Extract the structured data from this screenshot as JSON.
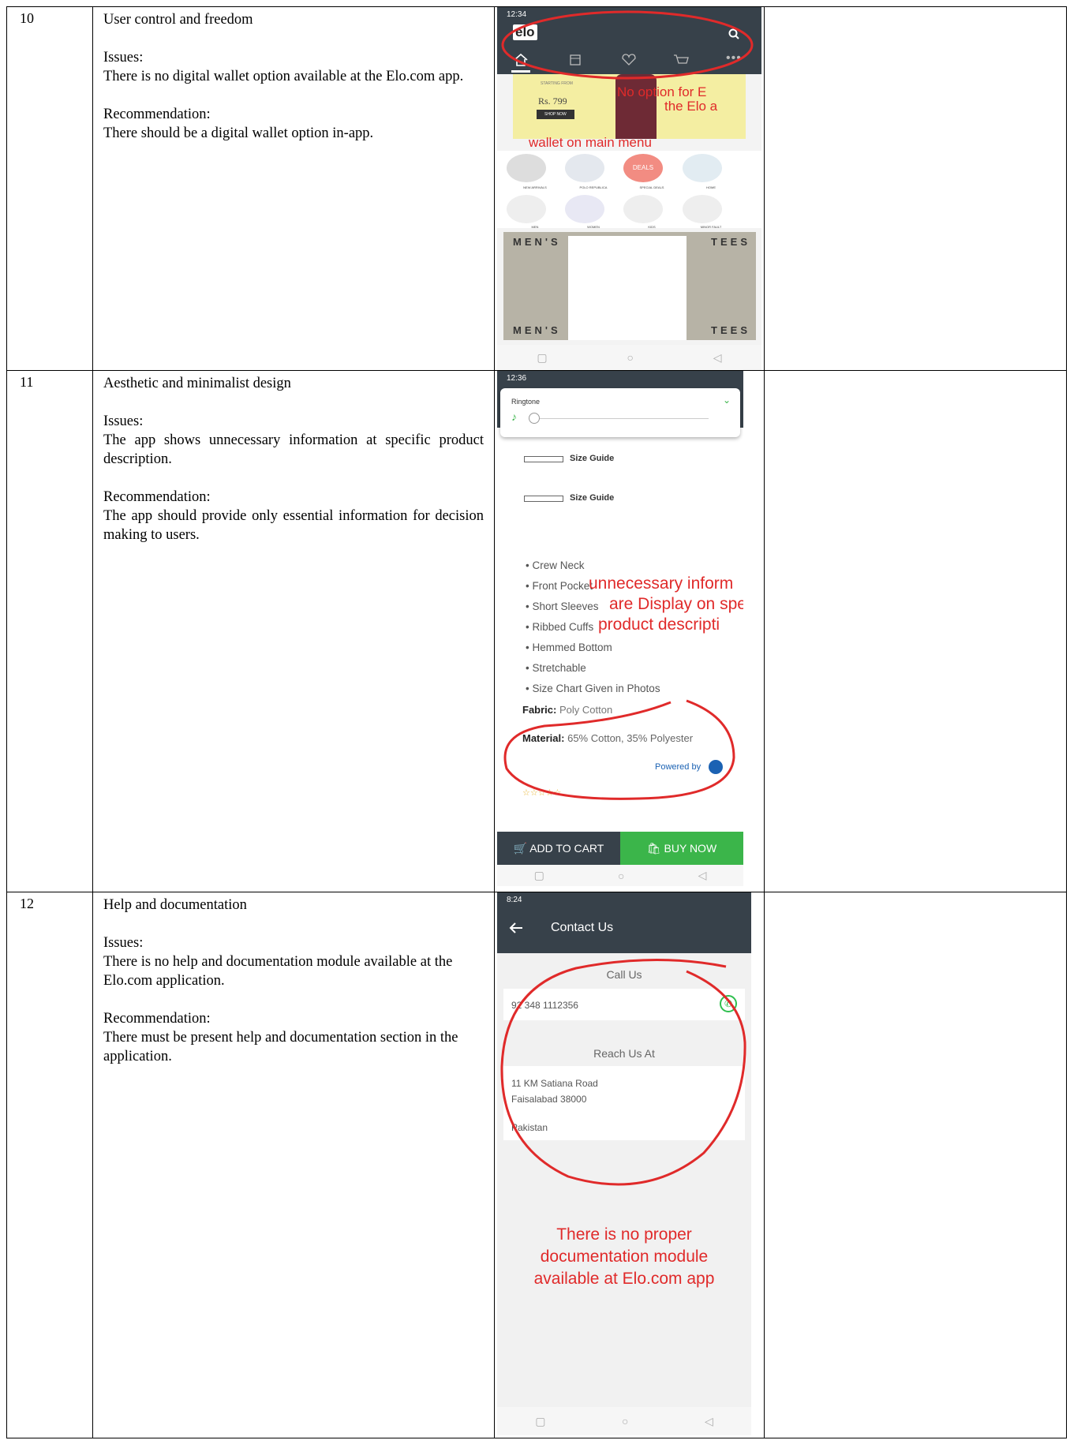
{
  "rows": [
    {
      "num": "10",
      "title": "User control and freedom",
      "issues_label": "Issues:",
      "issues_text": "There is no digital wallet option available at the Elo.com app.",
      "rec_label": "Recommendation:",
      "rec_text": "There should be a digital wallet option in-app.",
      "screen": {
        "status_time": "12:34",
        "logo": "elo",
        "banner_price": "Rs. 799",
        "banner_small": "STARTING FROM",
        "banner_button": "SHOP NOW",
        "annotation_1": "No option for E",
        "annotation_2": "the Elo a",
        "annotation_3": "wallet on main menu",
        "categories": [
          "NEW ARRIVALS",
          "POLO REPUBLICA",
          "SPECIAL DEALS",
          "HOME",
          "MEN",
          "WOMEN",
          "KIDS",
          "MINOR FAULT"
        ],
        "deals_label": "DEALS",
        "tees_left": "MEN'S",
        "tees_right": "TEES"
      }
    },
    {
      "num": "11",
      "title": "Aesthetic and minimalist design",
      "issues_label": "Issues:",
      "issues_text": "The app shows unnecessary information at specific product description.",
      "rec_label": "Recommendation:",
      "rec_text": "The app should provide only essential information for decision making to users.",
      "screen": {
        "status_time": "12:36",
        "ringtone_label": "Ringtone",
        "size_guide": "Size Guide",
        "bullets": [
          "Crew Neck",
          "Front Pocket",
          "Short Sleeves",
          "Ribbed Cuffs",
          "Hemmed Bottom",
          "Stretchable",
          "Size Chart Given in Photos"
        ],
        "annotation_1": "unnecessary inform",
        "annotation_2": "are Display on spe",
        "annotation_3": "product descripti",
        "fabric_label": "Fabric:",
        "fabric_value": "Poly Cotton",
        "material_label": "Material:",
        "material_value": "65% Cotton, 35% Polyester",
        "powered_by": "Powered by",
        "add_to_cart": "ADD TO CART",
        "buy_now": "BUY NOW"
      }
    },
    {
      "num": "12",
      "title": "Help and documentation",
      "issues_label": "Issues:",
      "issues_text": "There is no help and documentation module available at the Elo.com application.",
      "rec_label": "Recommendation:",
      "rec_text": "There must be present help and documentation section in the application.",
      "screen": {
        "status_time": "8:24",
        "header_title": "Contact Us",
        "call_us": "Call Us",
        "phone": "92 348 1112356",
        "reach_us": "Reach Us At",
        "address_1": "11 KM Satiana Road",
        "address_2": "Faisalabad 38000",
        "address_3": "Pakistan",
        "annotation_1": "There is no proper",
        "annotation_2": "documentation module",
        "annotation_3": "available at Elo.com app"
      }
    }
  ],
  "colors": {
    "annotation_red": "#e02a2a",
    "app_dark": "#37414a",
    "buy_green": "#3bb54a",
    "call_green": "#2fbf4f"
  }
}
